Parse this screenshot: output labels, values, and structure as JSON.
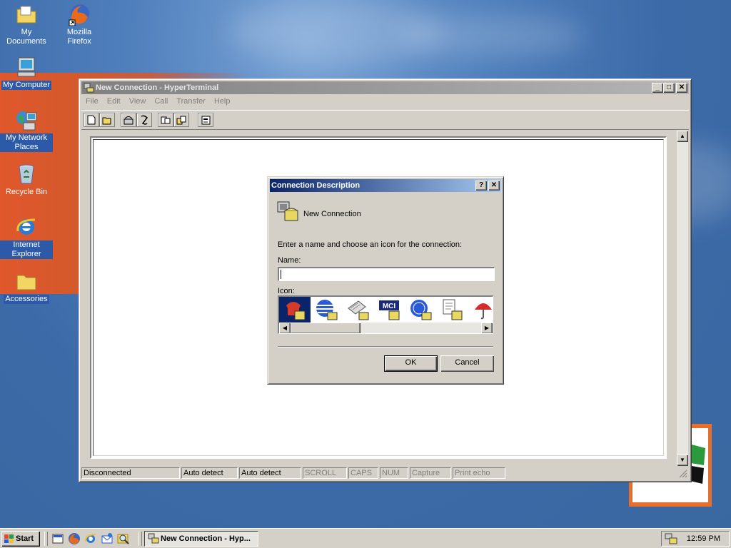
{
  "desktop": {
    "icons": [
      {
        "label": "My Documents"
      },
      {
        "label": "Mozilla Firefox"
      },
      {
        "label": "My Computer"
      },
      {
        "label": "My Network Places"
      },
      {
        "label": "Recycle Bin"
      },
      {
        "label": "Internet Explorer"
      },
      {
        "label": "Accessories"
      }
    ]
  },
  "window": {
    "title": "New Connection - HyperTerminal",
    "menu": [
      "File",
      "Edit",
      "View",
      "Call",
      "Transfer",
      "Help"
    ],
    "toolbar_icons": [
      "new-icon",
      "open-icon",
      "connect-icon",
      "disconnect-icon",
      "send-icon",
      "receive-icon",
      "properties-icon"
    ],
    "status": {
      "connection": "Disconnected",
      "detect1": "Auto detect",
      "detect2": "Auto detect",
      "scroll": "SCROLL",
      "caps": "CAPS",
      "num": "NUM",
      "capture": "Capture",
      "print_echo": "Print echo"
    }
  },
  "dialog": {
    "title": "Connection Description",
    "header": "New Connection",
    "instruction": "Enter a name and choose an icon for the connection:",
    "name_label": "Name:",
    "name_value": "",
    "icon_label": "Icon:",
    "icons": [
      "phone-icon",
      "globe-icon",
      "fax-icon",
      "mci-icon",
      "ge-icon",
      "document-icon",
      "umbrella-icon"
    ],
    "mci_text": "MCI",
    "ok": "OK",
    "cancel": "Cancel"
  },
  "taskbar": {
    "start": "Start",
    "task": "New Connection - Hyp...",
    "clock": "12:59 PM"
  }
}
